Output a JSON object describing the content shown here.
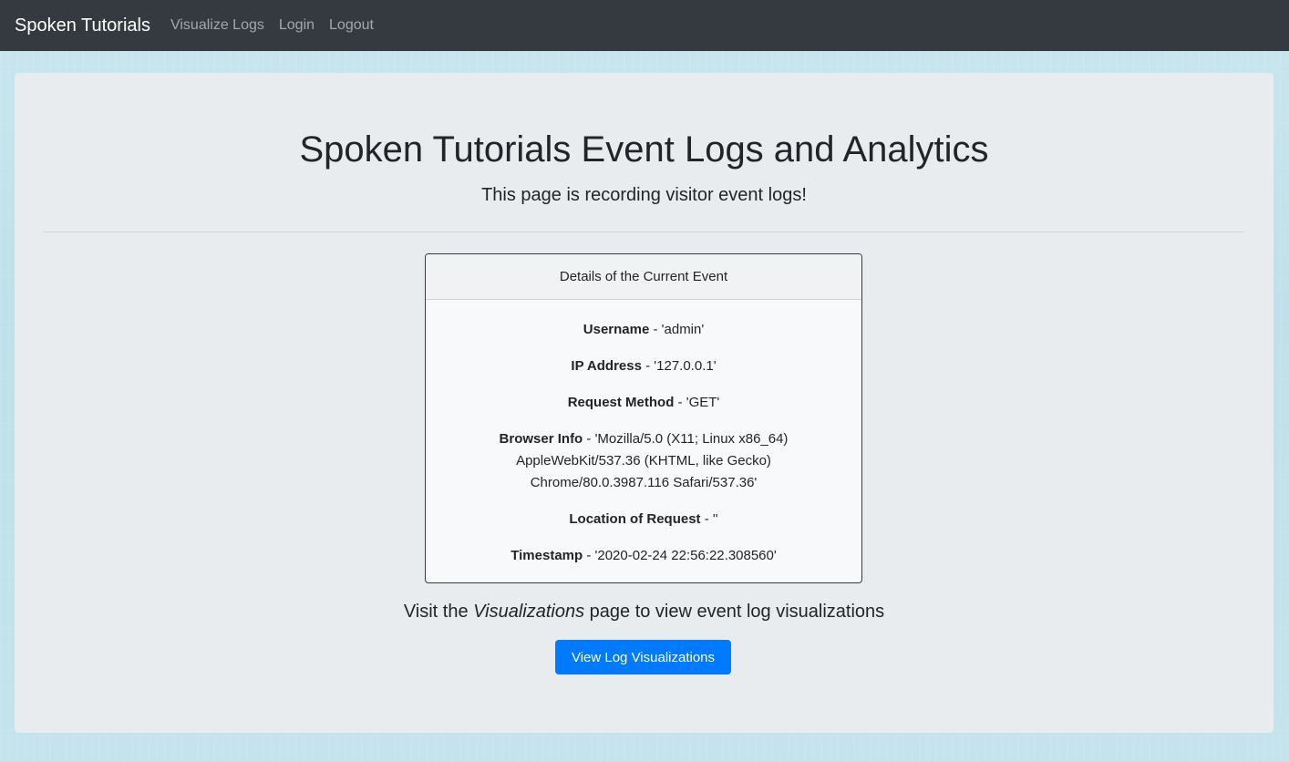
{
  "navbar": {
    "brand": "Spoken Tutorials",
    "links": [
      "Visualize Logs",
      "Login",
      "Logout"
    ]
  },
  "header": {
    "title": "Spoken Tutorials Event Logs and Analytics",
    "subtitle": "This page is recording visitor event logs!"
  },
  "event_card": {
    "title": "Details of the Current Event",
    "fields": [
      {
        "label": "Username",
        "value": " - 'admin'"
      },
      {
        "label": "IP Address",
        "value": " - '127.0.0.1'"
      },
      {
        "label": "Request Method",
        "value": " - 'GET'"
      },
      {
        "label": "Browser Info",
        "value": " - 'Mozilla/5.0 (X11; Linux x86_64) AppleWebKit/537.36 (KHTML, like Gecko) Chrome/80.0.3987.116 Safari/537.36'"
      },
      {
        "label": "Location of Request",
        "value": " - ''"
      },
      {
        "label": "Timestamp",
        "value": " - '2020-02-24 22:56:22.308560'"
      }
    ]
  },
  "visit": {
    "prefix": "Visit the ",
    "emphasis": "Visualizations",
    "suffix": " page to view event log visualizations"
  },
  "button": {
    "label": "View Log Visualizations",
    "color": "#007bff"
  },
  "colors": {
    "navbar": "#343a40",
    "jumbotron": "#e9ecef"
  }
}
